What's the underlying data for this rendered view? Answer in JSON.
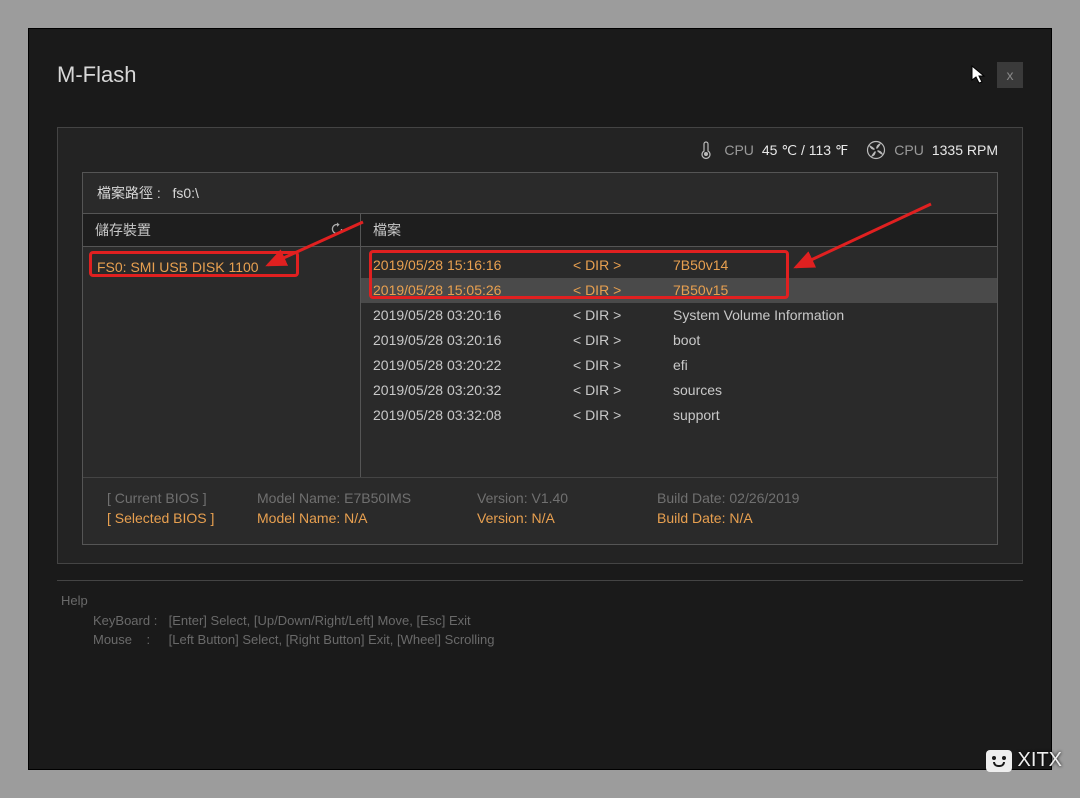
{
  "window": {
    "title": "M-Flash",
    "close": "x"
  },
  "status": {
    "cpu_temp_label": "CPU",
    "cpu_temp_value": "45 ℃ / 113 ℉",
    "cpu_fan_label": "CPU",
    "cpu_fan_value": "1335 RPM"
  },
  "path": {
    "label": "檔案路徑 :",
    "value": "fs0:\\"
  },
  "headers": {
    "storage": "儲存裝置",
    "files": "檔案"
  },
  "devices": [
    {
      "label": "FS0: SMI USB DISK 1100"
    }
  ],
  "files": [
    {
      "date": "2019/05/28 15:16:16",
      "type": "< DIR >",
      "name": "7B50v14",
      "highlight": true,
      "selected": false
    },
    {
      "date": "2019/05/28 15:05:26",
      "type": "< DIR >",
      "name": "7B50v15",
      "highlight": true,
      "selected": true
    },
    {
      "date": "2019/05/28 03:20:16",
      "type": "< DIR >",
      "name": "System Volume Information",
      "highlight": false,
      "selected": false
    },
    {
      "date": "2019/05/28 03:20:16",
      "type": "< DIR >",
      "name": "boot",
      "highlight": false,
      "selected": false
    },
    {
      "date": "2019/05/28 03:20:22",
      "type": "< DIR >",
      "name": "efi",
      "highlight": false,
      "selected": false
    },
    {
      "date": "2019/05/28 03:20:32",
      "type": "< DIR >",
      "name": "sources",
      "highlight": false,
      "selected": false
    },
    {
      "date": "2019/05/28 03:32:08",
      "type": "< DIR >",
      "name": "support",
      "highlight": false,
      "selected": false
    }
  ],
  "bios": {
    "current_label": "[ Current BIOS  ]",
    "selected_label": "[ Selected BIOS ]",
    "model_label": "Model Name:",
    "version_label": "Version:",
    "build_label": "Build Date:",
    "current": {
      "model": "E7B50IMS",
      "version": "V1.40",
      "build": "02/26/2019"
    },
    "selected": {
      "model": "N/A",
      "version": "N/A",
      "build": "N/A"
    }
  },
  "help": {
    "title": "Help",
    "kb_label": "KeyBoard :",
    "kb_text": "[Enter]  Select,    [Up/Down/Right/Left]  Move,    [Esc]  Exit",
    "mouse_label": "Mouse",
    "mouse_sep": ":",
    "mouse_text": "[Left Button]  Select,    [Right Button]  Exit,    [Wheel]  Scrolling"
  },
  "watermark": "XITX"
}
